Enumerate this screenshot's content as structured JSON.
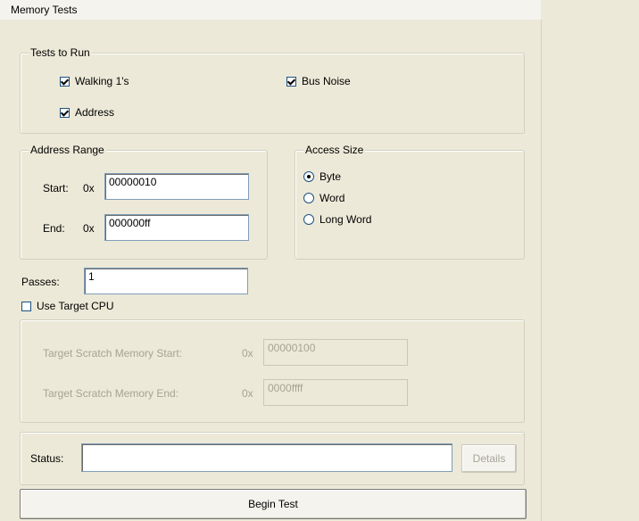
{
  "tab": {
    "title": "Memory Tests"
  },
  "tests_to_run": {
    "legend": "Tests to Run",
    "walking": {
      "label": "Walking 1's",
      "checked": true
    },
    "address": {
      "label": "Address",
      "checked": true
    },
    "bus_noise": {
      "label": "Bus Noise",
      "checked": true
    }
  },
  "address_range": {
    "legend": "Address Range",
    "start_label": "Start:",
    "end_label": "End:",
    "prefix": "0x",
    "start_value": "00000010",
    "end_value": "000000ff"
  },
  "access_size": {
    "legend": "Access Size",
    "options": [
      {
        "label": "Byte",
        "selected": true
      },
      {
        "label": "Word",
        "selected": false
      },
      {
        "label": "Long Word",
        "selected": false
      }
    ]
  },
  "passes": {
    "label": "Passes:",
    "value": "1"
  },
  "use_target_cpu": {
    "label": "Use Target CPU",
    "checked": false
  },
  "target_scratch": {
    "start_label": "Target Scratch Memory Start:",
    "end_label": "Target Scratch Memory End:",
    "prefix": "0x",
    "start_value": "00000100",
    "end_value": "0000ffff"
  },
  "status": {
    "label": "Status:",
    "value": "",
    "details_label": "Details"
  },
  "begin_test": {
    "label": "Begin Test"
  }
}
